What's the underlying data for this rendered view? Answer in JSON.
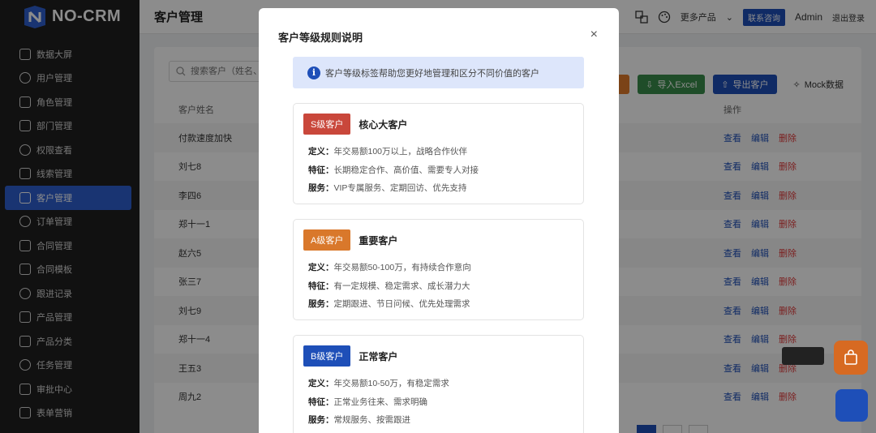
{
  "header": {
    "logo_text": "NO-CRM",
    "page_title": "客户管理",
    "more_products": "更多产品",
    "contact": "联系咨询",
    "user": "Admin",
    "logout": "退出登录"
  },
  "sidebar": {
    "items": [
      {
        "label": "数据大屏",
        "icon": "dashboard-icon"
      },
      {
        "label": "用户管理",
        "icon": "user-icon"
      },
      {
        "label": "角色管理",
        "icon": "lock-icon"
      },
      {
        "label": "部门管理",
        "icon": "team-icon"
      },
      {
        "label": "权限查看",
        "icon": "shield-icon"
      },
      {
        "label": "线索管理",
        "icon": "chart-icon"
      },
      {
        "label": "客户管理",
        "icon": "customer-icon",
        "active": true
      },
      {
        "label": "订单管理",
        "icon": "cart-icon"
      },
      {
        "label": "合同管理",
        "icon": "file-icon"
      },
      {
        "label": "合同模板",
        "icon": "template-icon"
      },
      {
        "label": "跟进记录",
        "icon": "history-icon"
      },
      {
        "label": "产品管理",
        "icon": "box-icon"
      },
      {
        "label": "产品分类",
        "icon": "folder-icon"
      },
      {
        "label": "任务管理",
        "icon": "task-icon"
      },
      {
        "label": "审批中心",
        "icon": "check-icon"
      },
      {
        "label": "表单营销",
        "icon": "form-icon"
      }
    ]
  },
  "toolbar": {
    "search_placeholder": "搜索客户（姓名、手",
    "import_label": "导入Excel",
    "export_label": "导出客户",
    "mock_label": "Mock数据"
  },
  "table": {
    "col_name": "客户姓名",
    "col_ops": "操作",
    "op_view": "查看",
    "op_edit": "编辑",
    "op_delete": "删除",
    "rows": [
      "付款速度加快",
      "刘七8",
      "李四6",
      "郑十一1",
      "赵六5",
      "张三7",
      "刘七9",
      "郑十一4",
      "王五3",
      "周九2"
    ]
  },
  "modal": {
    "title": "客户等级规则说明",
    "close": "×",
    "info_text": "客户等级标签帮助您更好地管理和区分不同价值的客户",
    "levels": [
      {
        "badge": "S级客户",
        "name": "核心大客户",
        "color": "#c9473b",
        "definition": "年交易额100万以上，战略合作伙伴",
        "feature": "长期稳定合作、高价值、需要专人对接",
        "service": "VIP专属服务、定期回访、优先支持"
      },
      {
        "badge": "A级客户",
        "name": "重要客户",
        "color": "#d9782b",
        "definition": "年交易额50-100万，有持续合作意向",
        "feature": "有一定规模、稳定需求、成长潜力大",
        "service": "定期跟进、节日问候、优先处理需求"
      },
      {
        "badge": "B级客户",
        "name": "正常客户",
        "color": "#1e4fb8",
        "definition": "年交易额10-50万，有稳定需求",
        "feature": "正常业务往来、需求明确",
        "service": "常规服务、按需跟进"
      }
    ],
    "label_definition": "定义：",
    "label_feature": "特征：",
    "label_service": "服务："
  }
}
